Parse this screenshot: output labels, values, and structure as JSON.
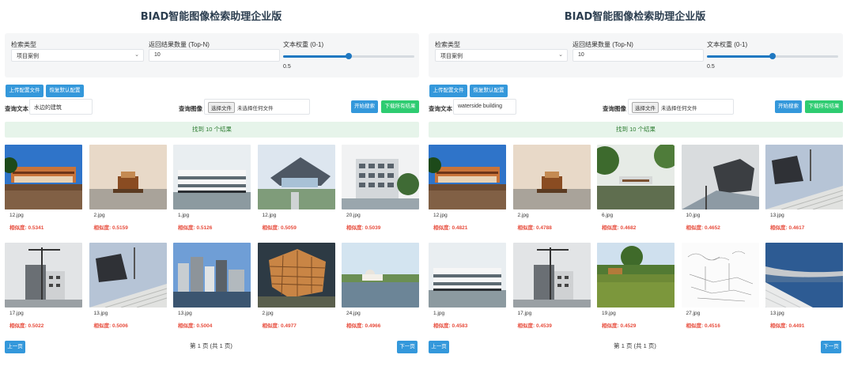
{
  "panels": [
    {
      "title": "BIAD智能图像检索助理企业版",
      "config": {
        "type_label": "检索类型",
        "type_value": "项目案例",
        "topn_label": "返回结果数量 (Top-N)",
        "topn_value": "10",
        "weight_label": "文本权重 (0-1)",
        "weight_value": "0.5",
        "weight_fraction": 0.5
      },
      "buttons": {
        "upload": "上传配置文件",
        "reset": "恢复默认配置",
        "search": "开始搜索",
        "download": "下载所有结果"
      },
      "query": {
        "text_label": "查询文本",
        "text_value": "水边的建筑",
        "image_label": "查询图像",
        "file_button": "选择文件",
        "file_status": "未选择任何文件"
      },
      "result_text": "找到 10 个结果",
      "results": [
        {
          "file": "12.jpg",
          "sim": "相似度: 0.5341",
          "icon": "photo-building-waterfront"
        },
        {
          "file": "2.jpg",
          "sim": "相似度: 0.5159",
          "icon": "photo-island-building"
        },
        {
          "file": "1.jpg",
          "sim": "相似度: 0.5126",
          "icon": "photo-white-building"
        },
        {
          "file": "12.jpg",
          "sim": "相似度: 0.5059",
          "icon": "photo-angled-roof"
        },
        {
          "file": "20.jpg",
          "sim": "相似度: 0.5039",
          "icon": "photo-apartment"
        },
        {
          "file": "17.jpg",
          "sim": "相似度: 0.5022",
          "icon": "photo-crane-building"
        },
        {
          "file": "13.jpg",
          "sim": "相似度: 0.5006",
          "icon": "photo-museum-steps"
        },
        {
          "file": "13.jpg",
          "sim": "相似度: 0.5004",
          "icon": "photo-city-skyline"
        },
        {
          "file": "2.jpg",
          "sim": "相似度: 0.4977",
          "icon": "photo-lattice-cube"
        },
        {
          "file": "24.jpg",
          "sim": "相似度: 0.4966",
          "icon": "photo-lake-dome"
        }
      ],
      "pager": {
        "prev": "上一页",
        "status": "第 1 页 (共 1 页)",
        "next": "下一页"
      }
    },
    {
      "title": "BIAD智能图像检索助理企业版",
      "config": {
        "type_label": "检索类型",
        "type_value": "项目案例",
        "topn_label": "返回结果数量 (Top-N)",
        "topn_value": "10",
        "weight_label": "文本权重 (0-1)",
        "weight_value": "0.5",
        "weight_fraction": 0.5
      },
      "buttons": {
        "upload": "上传配置文件",
        "reset": "恢复默认配置",
        "search": "开始搜索",
        "download": "下载所有结果"
      },
      "query": {
        "text_label": "查询文本",
        "text_value": "waterside building",
        "image_label": "查询图像",
        "file_button": "选择文件",
        "file_status": "未选择任何文件"
      },
      "result_text": "找到 10 个结果",
      "results": [
        {
          "file": "12.jpg",
          "sim": "相似度: 0.4821",
          "icon": "photo-building-waterfront"
        },
        {
          "file": "2.jpg",
          "sim": "相似度: 0.4788",
          "icon": "photo-island-building"
        },
        {
          "file": "6.jpg",
          "sim": "相似度: 0.4682",
          "icon": "photo-forest-lake"
        },
        {
          "file": "10.jpg",
          "sim": "相似度: 0.4652",
          "icon": "photo-dark-museum"
        },
        {
          "file": "13.jpg",
          "sim": "相似度: 0.4617",
          "icon": "photo-museum-steps"
        },
        {
          "file": "1.jpg",
          "sim": "相似度: 0.4583",
          "icon": "photo-white-building"
        },
        {
          "file": "17.jpg",
          "sim": "相似度: 0.4539",
          "icon": "photo-crane-building"
        },
        {
          "file": "19.jpg",
          "sim": "相似度: 0.4529",
          "icon": "photo-green-pond"
        },
        {
          "file": "27.jpg",
          "sim": "相似度: 0.4516",
          "icon": "photo-sketch"
        },
        {
          "file": "13.jpg",
          "sim": "相似度: 0.4491",
          "icon": "photo-curved-terrace"
        }
      ],
      "pager": {
        "prev": "上一页",
        "status": "第 1 页 (共 1 页)",
        "next": "下一页"
      }
    }
  ]
}
